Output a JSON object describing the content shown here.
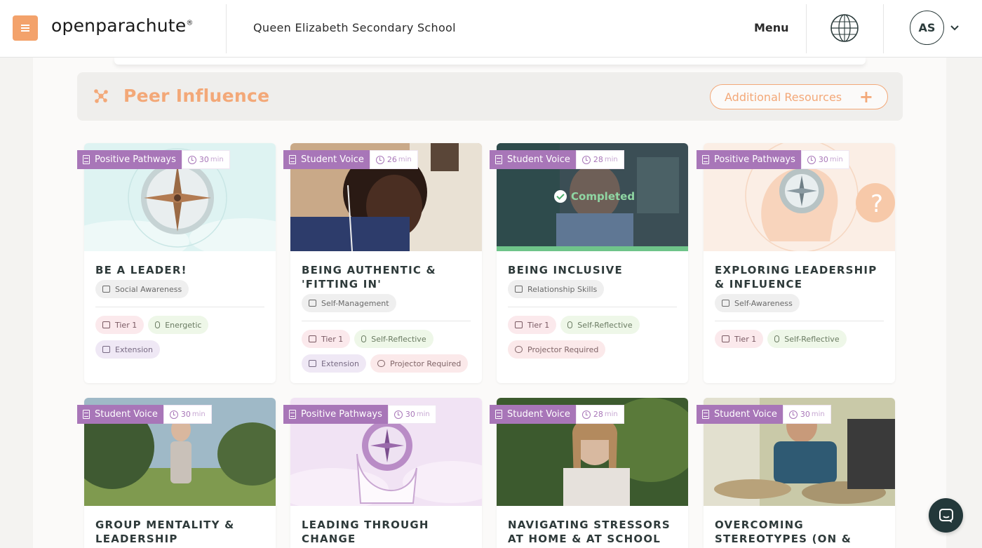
{
  "header": {
    "logo_text": "openparachute",
    "logo_mark": "®",
    "school_name": "Queen Elizabeth Secondary School",
    "menu_label": "Menu",
    "avatar_initials": "AS",
    "icons": [
      "hamburger-icon",
      "globe-language-icon",
      "chevron-down-icon"
    ]
  },
  "section": {
    "title": "Peer Influence",
    "additional_resources_label": "Additional Resources",
    "plus": "+",
    "icon": "peer-network-icon"
  },
  "colors": {
    "accent_orange": "#f3a26b",
    "label_purple": "#a876b8",
    "completed_green": "#6fc48a",
    "title_dark": "#2e3a3a"
  },
  "cards": [
    {
      "type": "Positive Pathways",
      "time": "30",
      "unit": "min",
      "title": "BE A LEADER!",
      "skill": "Social Awareness",
      "tier": "Tier 1",
      "mood": "Energetic",
      "extras": [
        "Extension"
      ],
      "completed": false
    },
    {
      "type": "Student Voice",
      "time": "26",
      "unit": "min",
      "title": "BEING AUTHENTIC & 'FITTING IN'",
      "skill": "Self-Management",
      "tier": "Tier 1",
      "mood": "Self-Reflective",
      "extras": [
        "Extension",
        "Projector Required"
      ],
      "completed": false
    },
    {
      "type": "Student Voice",
      "time": "28",
      "unit": "min",
      "title": "BEING INCLUSIVE",
      "skill": "Relationship Skills",
      "tier": "Tier 1",
      "mood": "Self-Reflective",
      "extras": [
        "Projector Required"
      ],
      "completed": true,
      "completed_label": "Completed"
    },
    {
      "type": "Positive Pathways",
      "time": "30",
      "unit": "min",
      "title": "EXPLORING LEADERSHIP & INFLUENCE",
      "skill": "Self-Awareness",
      "tier": "Tier 1",
      "mood": "Self-Reflective",
      "extras": [],
      "completed": false
    },
    {
      "type": "Student Voice",
      "time": "30",
      "unit": "min",
      "title": "GROUP MENTALITY & LEADERSHIP"
    },
    {
      "type": "Positive Pathways",
      "time": "30",
      "unit": "min",
      "title": "LEADING THROUGH CHANGE"
    },
    {
      "type": "Student Voice",
      "time": "28",
      "unit": "min",
      "title": "NAVIGATING STRESSORS AT HOME & AT SCHOOL"
    },
    {
      "type": "Student Voice",
      "time": "30",
      "unit": "min",
      "title": "OVERCOMING STEREOTYPES (ON &"
    }
  ]
}
